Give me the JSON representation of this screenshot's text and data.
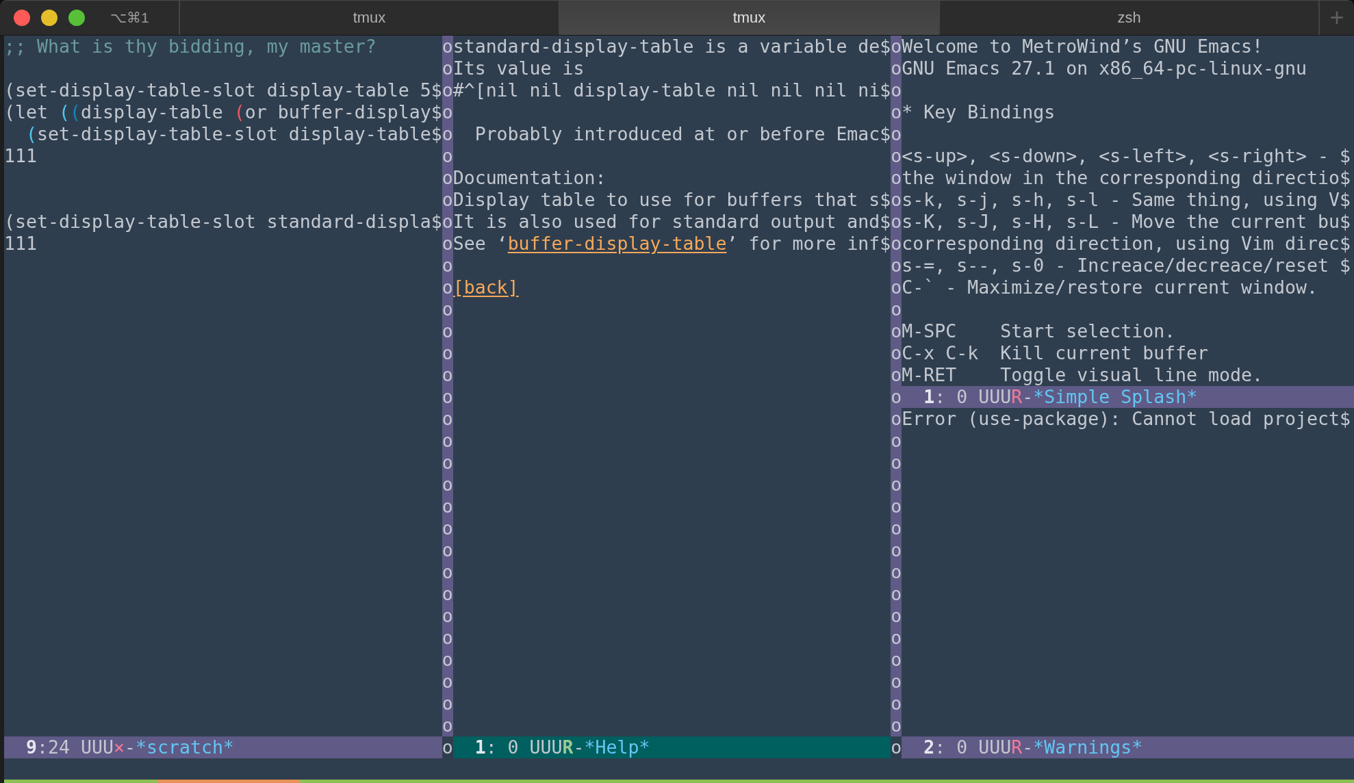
{
  "title_bar": {
    "shortcut": "⌥⌘1",
    "tabs": [
      {
        "label": "tmux",
        "selected": false
      },
      {
        "label": "tmux",
        "selected": true
      },
      {
        "label": "zsh",
        "selected": false
      }
    ],
    "new_tab": "+"
  },
  "emacs": {
    "columns": [
      {
        "windows": [
          {
            "active": false,
            "lines": [
              {
                "kind": "comment",
                "text": ";; What is thy bidding, my master?"
              },
              {
                "kind": "blank"
              },
              {
                "kind": "code",
                "text": "(set-display-table-slot display-table 5$"
              },
              {
                "kind": "code",
                "parts": [
                  {
                    "kind": "plain",
                    "text": "(let "
                  },
                  {
                    "kind": "paren",
                    "text": "(",
                    "color": "#4fc8f2"
                  },
                  {
                    "kind": "paren",
                    "text": "(",
                    "color": "#0a8cbc"
                  },
                  {
                    "kind": "plain",
                    "text": "display-table "
                  },
                  {
                    "kind": "paren",
                    "text": "(",
                    "color": "#e85a5f"
                  },
                  {
                    "kind": "plain",
                    "text": "or buffer-display$"
                  }
                ],
                "children": [
                  {
                    "kind": "code",
                    "parts": [
                      {
                        "kind": "paren",
                        "text": "(",
                        "color": "#4fc8f2"
                      },
                      {
                        "kind": "plain",
                        "text": "set-display-table-slot display-table$"
                      }
                    ]
                  }
                ]
              },
              {
                "kind": "code",
                "text": "111"
              },
              {
                "kind": "blank"
              },
              {
                "kind": "blank"
              },
              {
                "kind": "code",
                "text": "(set-display-table-slot standard-displa$"
              },
              {
                "kind": "code",
                "text": "111"
              }
            ],
            "mode_line": {
              "position": "**9**:24",
              "coding": "UUU",
              "flag": "×",
              "separator": "-",
              "buffer": "*scratch*"
            }
          }
        ]
      },
      {
        "windows": [
          {
            "active": true,
            "lines": [
              {
                "kind": "text",
                "text": "standard-display-table is a variable de$"
              },
              {
                "kind": "text",
                "text": "Its value is"
              },
              {
                "kind": "text",
                "text": "#^[nil nil display-table nil nil nil ni$"
              },
              {
                "kind": "blank"
              },
              {
                "kind": "text",
                "text": "  Probably introduced at or before Emac$"
              },
              {
                "kind": "blank"
              },
              {
                "kind": "text",
                "text": "Documentation:"
              },
              {
                "kind": "text",
                "text": "Display table to use for buffers that s$"
              },
              {
                "kind": "text",
                "text": "It is also used for standard output and$"
              },
              {
                "kind": "text",
                "parts": [
                  {
                    "kind": "plain",
                    "text": "See ‘"
                  },
                  {
                    "kind": "link",
                    "text": "buffer-display-table"
                  },
                  {
                    "kind": "plain",
                    "text": "’ for more inf$"
                  }
                ]
              },
              {
                "kind": "blank"
              },
              {
                "kind": "link",
                "text": "[back]"
              }
            ],
            "mode_line": {
              "position": "**1**: 0",
              "coding": "UUU",
              "flag": "R",
              "separator": "-",
              "buffer": "*Help*"
            }
          }
        ]
      },
      {
        "windows": [
          {
            "active": false,
            "lines": [
              {
                "kind": "text",
                "text": "Welcome to MetroWind’s GNU Emacs!"
              },
              {
                "kind": "text",
                "text": "GNU Emacs 27.1 on x86_64-pc-linux-gnu"
              },
              {
                "kind": "blank"
              },
              {
                "kind": "text",
                "text": "* Key Bindings"
              },
              {
                "kind": "blank"
              },
              {
                "kind": "text",
                "text": "<s-up>, <s-down>, <s-left>, <s-right> - $"
              },
              {
                "kind": "text",
                "text": "the window in the corresponding directio$"
              },
              {
                "kind": "text",
                "text": "s-k, s-j, s-h, s-l - Same thing, using V$"
              },
              {
                "kind": "text",
                "text": "s-K, s-J, s-H, s-L - Move the current bu$"
              },
              {
                "kind": "text",
                "text": "corresponding direction, using Vim direc$"
              },
              {
                "kind": "text",
                "text": "s-=, s--, s-0 - Increace/decreace/reset $"
              },
              {
                "kind": "text",
                "text": "C-` - Maximize/restore current window."
              },
              {
                "kind": "blank"
              },
              {
                "kind": "text",
                "text": "M-SPC    Start selection."
              },
              {
                "kind": "text",
                "text": "C-x C-k  Kill current buffer"
              },
              {
                "kind": "text",
                "text": "M-RET    Toggle visual line mode."
              }
            ],
            "mode_line": {
              "position": "**1**: 0",
              "coding": "UUU",
              "flag": "R",
              "separator": "-",
              "buffer": "*Simple Splash*"
            }
          },
          {
            "active": false,
            "lines": [
              {
                "kind": "text",
                "text": "Error (use-package): Cannot load project$"
              }
            ],
            "mode_line": {
              "position": "**2**: 0",
              "coding": "UUU",
              "flag": "R",
              "separator": "-",
              "buffer": "*Warnings*"
            }
          }
        ]
      }
    ],
    "dividers": [
      {
        "glyphs": "oooooooooooooooooooooooooooooooo",
        "mode_line_glyph": "o"
      },
      {
        "glyphs": "oooooooooooooooooooooooooooooooo",
        "mode_line_glyph": "o"
      }
    ]
  }
}
